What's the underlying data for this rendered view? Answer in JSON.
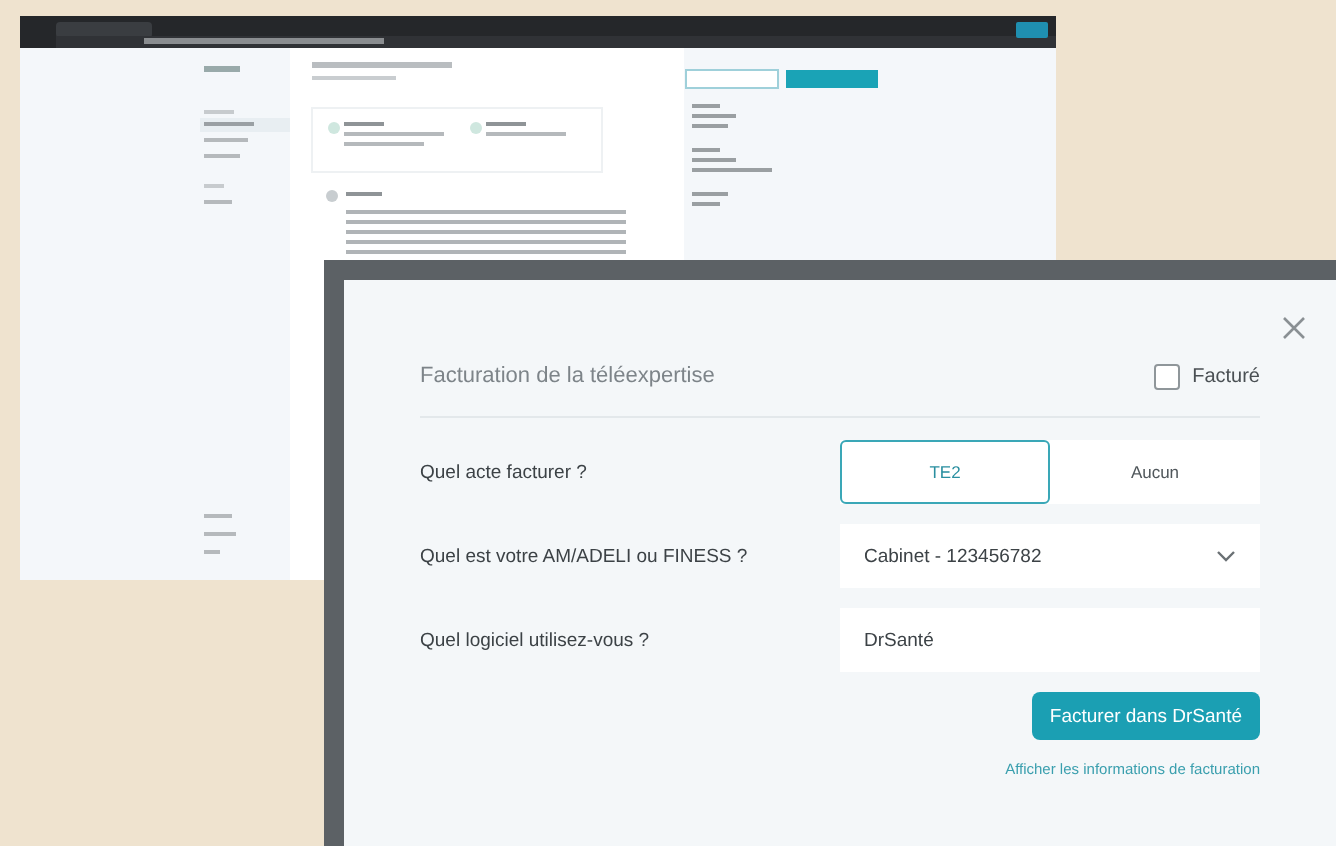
{
  "billing_dialog": {
    "title": "Facturation de la téléexpertise",
    "billed_checkbox": {
      "label": "Facturé",
      "checked": false
    },
    "questions": [
      {
        "kind": "segmented",
        "label": "Quel acte facturer ?",
        "options": [
          {
            "label": "TE2",
            "selected": true
          },
          {
            "label": "Aucun",
            "selected": false
          }
        ]
      },
      {
        "kind": "select",
        "label": "Quel est votre AM/ADELI ou FINESS ?",
        "value": "Cabinet - 123456782"
      },
      {
        "kind": "input",
        "label": "Quel logiciel utilisez-vous ?",
        "value": "DrSanté"
      }
    ],
    "primary_button": "Facturer dans DrSanté",
    "info_link": "Afficher les informations de facturation"
  }
}
